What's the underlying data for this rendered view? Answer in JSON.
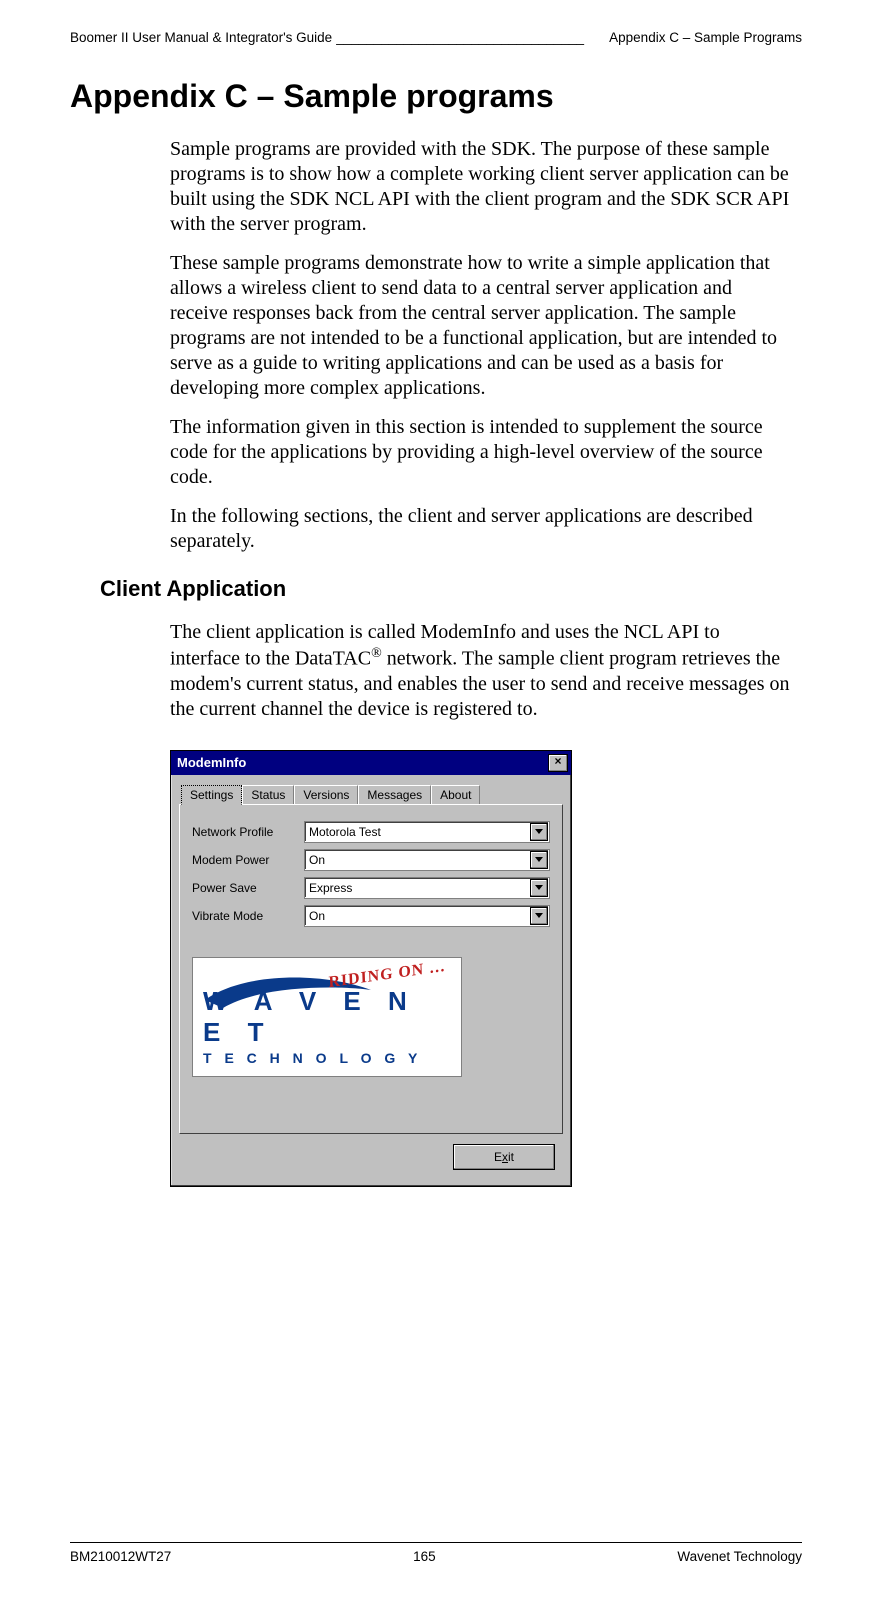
{
  "header": {
    "doc_title": "Boomer II User Manual & Integrator's Guide",
    "section": "Appendix C – Sample Programs",
    "underscores": "_________________________________"
  },
  "title": "Appendix C – Sample programs",
  "paragraphs": {
    "p1": "Sample programs are provided with the SDK. The purpose of these sample programs is to show how a complete working client server application can be built using the SDK NCL API with the client program and the SDK SCR API with the server program.",
    "p2": "These sample programs demonstrate how to write a simple application that allows a wireless client to send data to a central server application and receive responses back from the central server application. The sample programs are not intended to be a functional application, but are intended to serve as a guide to writing applications and can be used as a basis for developing more complex applications.",
    "p3": "The information given in this section is intended to supplement the source code for the applications by providing a high-level overview of the source code.",
    "p4": "In the following sections, the client and server applications are described separately."
  },
  "h2": "Client Application",
  "client_para_pre": "The client application is called ModemInfo and uses the NCL API to interface to the DataTAC",
  "client_para_post": " network. The sample client program retrieves the modem's current status, and enables the user to send and receive messages on the current channel the device is registered to.",
  "reg": "®",
  "win": {
    "title": "ModemInfo",
    "close": "×",
    "tabs": [
      "Settings",
      "Status",
      "Versions",
      "Messages",
      "About"
    ],
    "rows": [
      {
        "label": "Network Profile",
        "value": "Motorola Test"
      },
      {
        "label": "Modem Power",
        "value": "On"
      },
      {
        "label": "Power Save",
        "value": "Express"
      },
      {
        "label": "Vibrate Mode",
        "value": "On"
      }
    ],
    "logo": {
      "riding": "RIDING ON …",
      "wave": "W A V E N E T",
      "tech": "T E C H N O L O G Y"
    },
    "exit_pre": "E",
    "exit_u": "x",
    "exit_post": "it"
  },
  "footer": {
    "left": "BM210012WT27",
    "center": "165",
    "right": "Wavenet Technology"
  }
}
